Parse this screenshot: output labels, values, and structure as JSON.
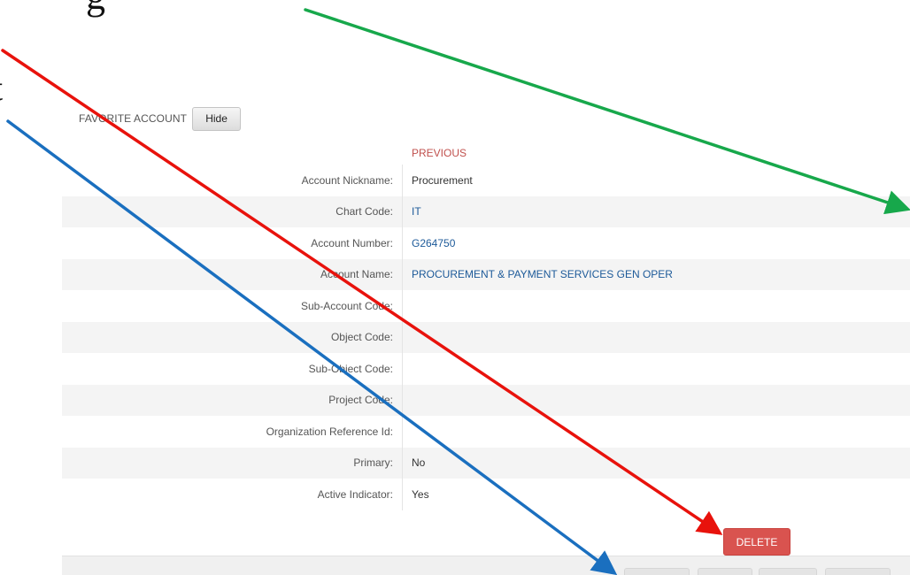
{
  "annotation": {
    "partial_top_text": "g",
    "partial_left_text": "t",
    "arrow_colors": {
      "green": "#17a84b",
      "red": "#e8120c",
      "blue": "#1a6fbf"
    }
  },
  "section": {
    "title": "FAVORITE ACCOUNT",
    "hide_label": "Hide"
  },
  "table": {
    "column_header": "PREVIOUS",
    "rows": [
      {
        "label": "Account Nickname:",
        "value": "Procurement"
      },
      {
        "label": "Chart Code:",
        "value": "IT"
      },
      {
        "label": "Account Number:",
        "value": "G264750"
      },
      {
        "label": "Account Name:",
        "value": "PROCUREMENT & PAYMENT SERVICES GEN OPER"
      },
      {
        "label": "Sub-Account Code:",
        "value": ""
      },
      {
        "label": "Object Code:",
        "value": ""
      },
      {
        "label": "Sub-Object Code:",
        "value": ""
      },
      {
        "label": "Project Code:",
        "value": ""
      },
      {
        "label": "Organization Reference Id:",
        "value": ""
      },
      {
        "label": "Primary:",
        "value": "No"
      },
      {
        "label": "Active Indicator:",
        "value": "Yes"
      }
    ]
  },
  "actions": {
    "delete_label": "DELETE"
  },
  "colors": {
    "previous_header": "#c0504d",
    "link_value": "#1d5a99",
    "delete_button": "#d9534f"
  }
}
